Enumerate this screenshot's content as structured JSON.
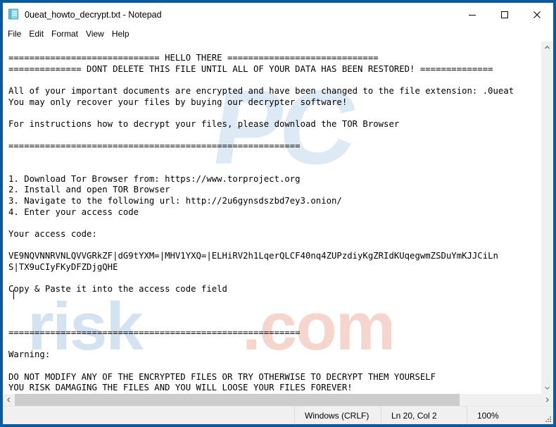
{
  "window": {
    "title": "0ueat_howto_decrypt.txt - Notepad",
    "icon": "notepad-icon",
    "border_color": "#0a5aa0",
    "controls": {
      "minimize": "—",
      "maximize": "□",
      "close": "✕"
    }
  },
  "menubar": {
    "items": [
      {
        "label": "File"
      },
      {
        "label": "Edit"
      },
      {
        "label": "Format"
      },
      {
        "label": "View"
      },
      {
        "label": "Help"
      }
    ]
  },
  "document": {
    "lines": [
      "============================= HELLO THERE =============================",
      "============== DONT DELETE THIS FILE UNTIL ALL OF YOUR DATA HAS BEEN RESTORED! ==============",
      "",
      "All of your important documents are encrypted and have been changed to the file extension: .0ueat",
      "You may only recover your files by buying our decrypter software!",
      "",
      "For instructions how to decrypt your files, please download the TOR Browser",
      "",
      "========================================================",
      "",
      "",
      "1. Download Tor Browser from: https://www.torproject.org",
      "2. Install and open TOR Browser",
      "3. Navigate to the following url: http://2u6gynsdszbd7ey3.onion/",
      "4. Enter your access code",
      "",
      "Your access code:",
      "",
      "VE9NQVNNRVNLQVVGRkZF|dG9tYXM=|MHV1YXQ=|ELHiRV2h1LqerQLCF40nq4ZUPzdiyKgZRIdKUqegwmZSDuYmKJJCiLn",
      "S|TX9uCIyFKyDFZDjgQHE",
      "",
      "Copy & Paste it into the access code field",
      "",
      "",
      "",
      "========================================================",
      "",
      "Warning:",
      "",
      "DO NOT MODIFY ANY OF THE ENCRYPTED FILES OR TRY OTHERWISE TO DECRYPT THEM YOURSELF",
      "YOU RISK DAMAGING THE FILES AND YOU WILL LOOSE YOUR FILES FOREVER!"
    ]
  },
  "watermark": {
    "top": "PC",
    "bottom_left": "risk",
    "bottom_right": ".com"
  },
  "scrollbars": {
    "vertical": {
      "up_arrow": "⌃",
      "down_arrow": "⌄"
    },
    "horizontal": {
      "left_arrow": "‹",
      "right_arrow": "›"
    }
  },
  "statusbar": {
    "encoding": "Windows (CRLF)",
    "position": "Ln 20, Col 2",
    "zoom": "100%"
  }
}
